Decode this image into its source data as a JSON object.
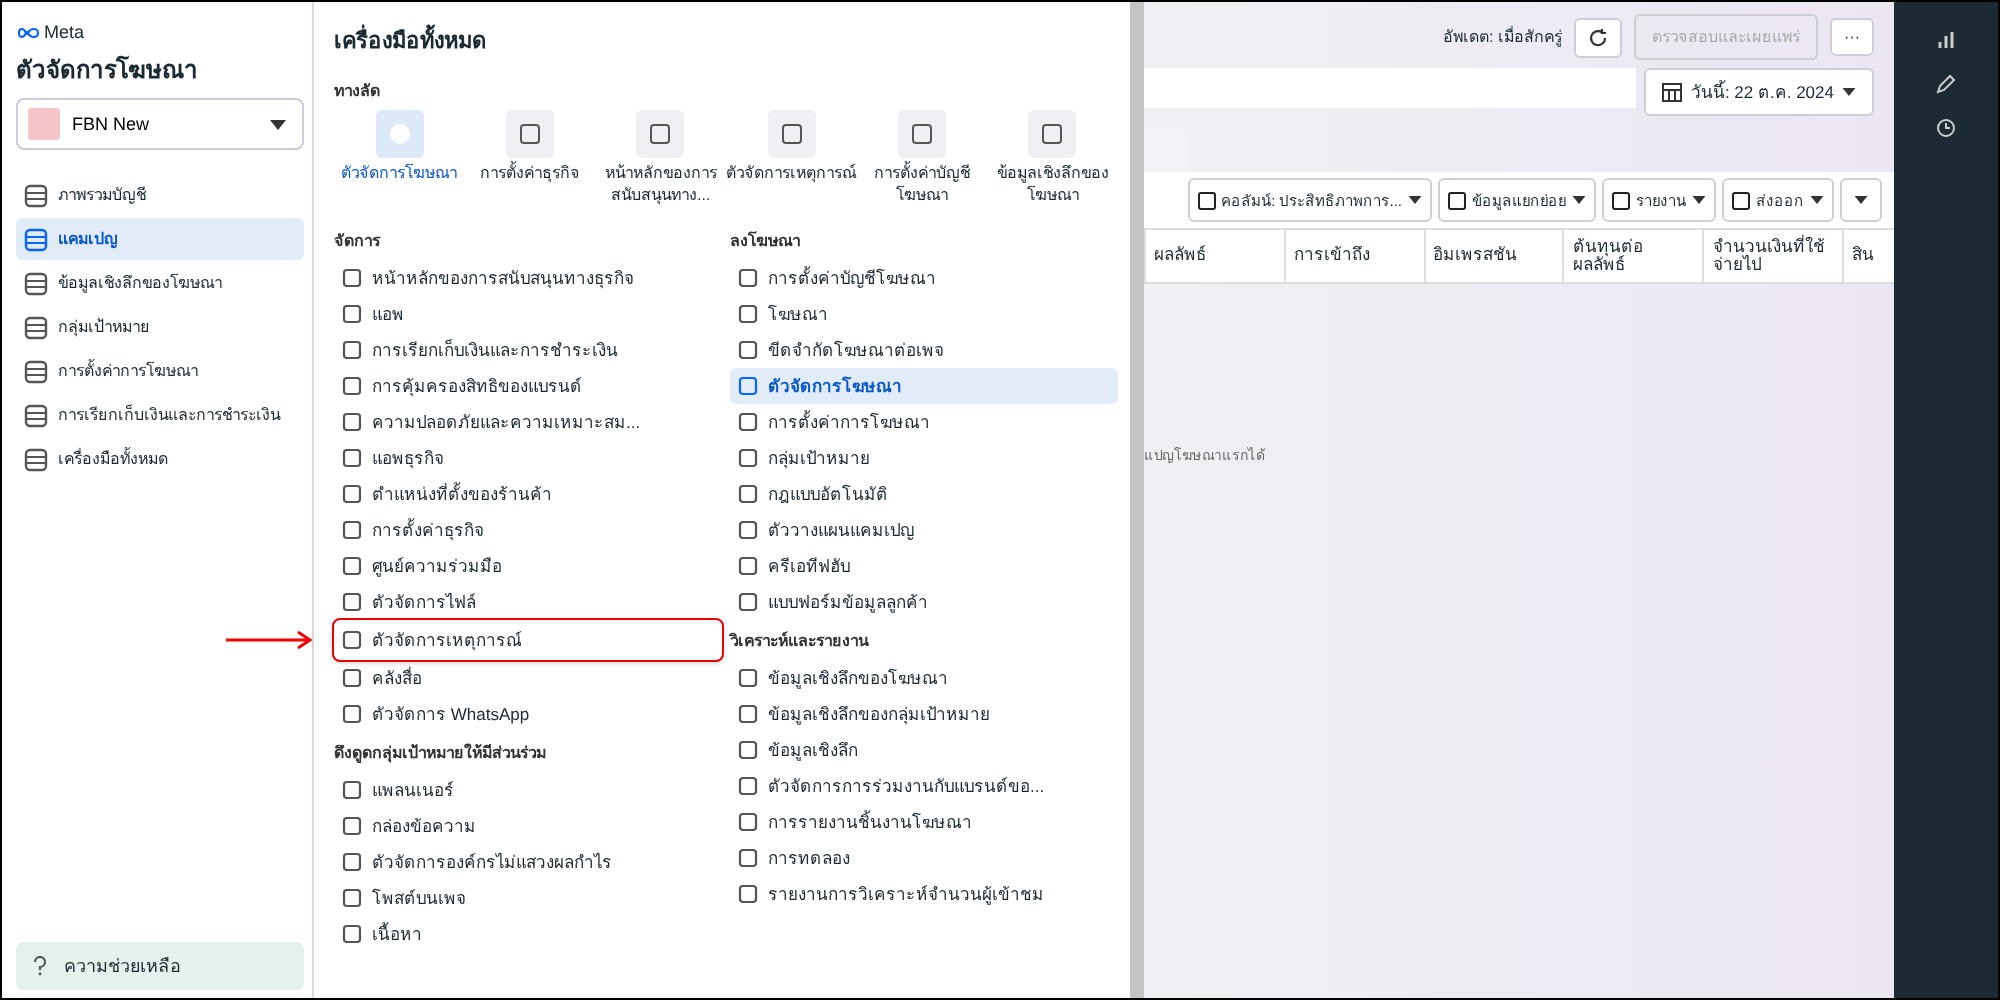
{
  "sidebar": {
    "logo": "Meta",
    "title": "ตัวจัดการโฆษณา",
    "account": {
      "name": "FBN New"
    },
    "items": [
      {
        "label": "ภาพรวมบัญชี",
        "selected": false
      },
      {
        "label": "แคมเปญ",
        "selected": true
      },
      {
        "label": "ข้อมูลเชิงลึกของโฆษณา",
        "selected": false
      },
      {
        "label": "กลุ่มเป้าหมาย",
        "selected": false
      },
      {
        "label": "การตั้งค่าการโฆษณา",
        "selected": false
      },
      {
        "label": "การเรียกเก็บเงินและการชำระเงิน",
        "selected": false
      },
      {
        "label": "เครื่องมือทั้งหมด",
        "selected": false
      }
    ],
    "help": "ความช่วยเหลือ"
  },
  "tools_menu": {
    "title": "เครื่องมือทั้งหมด",
    "shortcuts_heading": "ทางลัด",
    "shortcuts": [
      {
        "label": "ตัวจัดการโฆษณา",
        "selected": true
      },
      {
        "label": "การตั้งค่าธุรกิจ",
        "selected": false
      },
      {
        "label": "หน้าหลักของการสนับสนุนทาง...",
        "selected": false
      },
      {
        "label": "ตัวจัดการเหตุการณ์",
        "selected": false
      },
      {
        "label": "การตั้งค่าบัญชีโฆษณา",
        "selected": false
      },
      {
        "label": "ข้อมูลเชิงลึกของโฆษณา",
        "selected": false
      }
    ],
    "columns": [
      [
        {
          "heading": "จัดการ",
          "items": [
            {
              "label": "หน้าหลักของการสนับสนุนทางธุรกิจ",
              "selected": false,
              "highlighted": false
            },
            {
              "label": "แอพ",
              "selected": false,
              "highlighted": false
            },
            {
              "label": "การเรียกเก็บเงินและการชำระเงิน",
              "selected": false,
              "highlighted": false
            },
            {
              "label": "การคุ้มครองสิทธิของแบรนด์",
              "selected": false,
              "highlighted": false
            },
            {
              "label": "ความปลอดภัยและความเหมาะสม...",
              "selected": false,
              "highlighted": false
            },
            {
              "label": "แอพธุรกิจ",
              "selected": false,
              "highlighted": false
            },
            {
              "label": "ตำแหน่งที่ตั้งของร้านค้า",
              "selected": false,
              "highlighted": false
            },
            {
              "label": "การตั้งค่าธุรกิจ",
              "selected": false,
              "highlighted": false
            },
            {
              "label": "ศูนย์ความร่วมมือ",
              "selected": false,
              "highlighted": false
            },
            {
              "label": "ตัวจัดการไฟล์",
              "selected": false,
              "highlighted": false
            },
            {
              "label": "ตัวจัดการเหตุการณ์",
              "selected": false,
              "highlighted": true
            },
            {
              "label": "คลังสื่อ",
              "selected": false,
              "highlighted": false
            },
            {
              "label": "ตัวจัดการ WhatsApp",
              "selected": false,
              "highlighted": false
            }
          ]
        },
        {
          "heading": "ดึงดูดกลุ่มเป้าหมายให้มีส่วนร่วม",
          "items": [
            {
              "label": "แพลนเนอร์",
              "selected": false,
              "highlighted": false
            },
            {
              "label": "กล่องข้อความ",
              "selected": false,
              "highlighted": false
            },
            {
              "label": "ตัวจัดการองค์กรไม่แสวงผลกำไร",
              "selected": false,
              "highlighted": false
            },
            {
              "label": "โพสต์บนเพจ",
              "selected": false,
              "highlighted": false
            },
            {
              "label": "เนื้อหา",
              "selected": false,
              "highlighted": false
            }
          ]
        }
      ],
      [
        {
          "heading": "ลงโฆษณา",
          "items": [
            {
              "label": "การตั้งค่าบัญชีโฆษณา",
              "selected": false,
              "highlighted": false
            },
            {
              "label": "โฆษณา",
              "selected": false,
              "highlighted": false
            },
            {
              "label": "ขีดจำกัดโฆษณาต่อเพจ",
              "selected": false,
              "highlighted": false
            },
            {
              "label": "ตัวจัดการโฆษณา",
              "selected": true,
              "highlighted": false
            },
            {
              "label": "การตั้งค่าการโฆษณา",
              "selected": false,
              "highlighted": false
            },
            {
              "label": "กลุ่มเป้าหมาย",
              "selected": false,
              "highlighted": false
            },
            {
              "label": "กฎแบบอัตโนมัติ",
              "selected": false,
              "highlighted": false
            },
            {
              "label": "ตัววางแผนแคมเปญ",
              "selected": false,
              "highlighted": false
            },
            {
              "label": "ครีเอทีฟฮับ",
              "selected": false,
              "highlighted": false
            },
            {
              "label": "แบบฟอร์มข้อมูลลูกค้า",
              "selected": false,
              "highlighted": false
            }
          ]
        },
        {
          "heading": "วิเคราะห์และรายงาน",
          "items": [
            {
              "label": "ข้อมูลเชิงลึกของโฆษณา",
              "selected": false,
              "highlighted": false
            },
            {
              "label": "ข้อมูลเชิงลึกของกลุ่มเป้าหมาย",
              "selected": false,
              "highlighted": false
            },
            {
              "label": "ข้อมูลเชิงลึก",
              "selected": false,
              "highlighted": false
            },
            {
              "label": "ตัวจัดการการร่วมงานกับแบรนด์ขอ...",
              "selected": false,
              "highlighted": false
            },
            {
              "label": "การรายงานชิ้นงานโฆษณา",
              "selected": false,
              "highlighted": false
            },
            {
              "label": "การทดลอง",
              "selected": false,
              "highlighted": false
            },
            {
              "label": "รายงานการวิเคราะห์จำนวนผู้เข้าชม",
              "selected": false,
              "highlighted": false
            }
          ]
        }
      ]
    ]
  },
  "campaigns": {
    "updated": "อัพเดต: เมื่อสักครู่",
    "review_button": {
      "label": "ตรวจสอบและเผยแพร่",
      "disabled": true
    },
    "more_button": "···",
    "date": "วันนี้: 22 ต.ค. 2024",
    "toolbar": [
      "คอลัมน์: ประสิทธิภาพการ...",
      "ข้อมูลแยกย่อย",
      "รายงาน",
      "ส่งออก"
    ],
    "columns": [
      "ผลลัพธ์",
      "การเข้าถึง",
      "อิมเพรสชัน",
      "ต้นทุนต่อผลลัพธ์",
      "จำนวนเงินที่ใช้จ่ายไป",
      "สิน"
    ],
    "empty_text": "แปญโฆษณาแรกได้"
  }
}
